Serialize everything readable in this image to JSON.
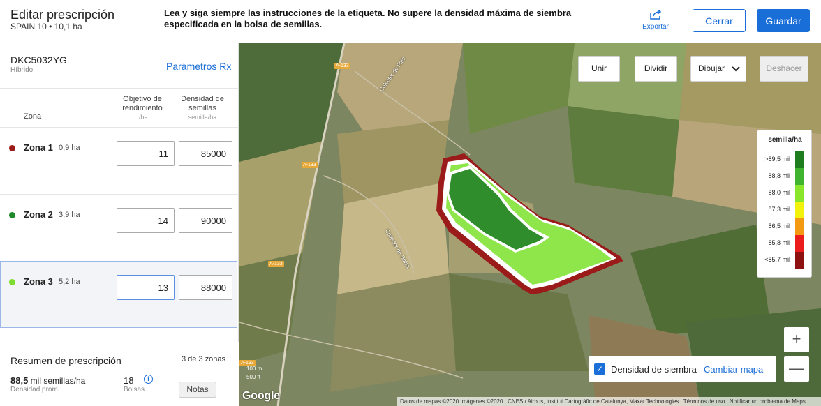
{
  "header": {
    "title": "Editar prescripción",
    "subtitle": "SPAIN 10 • 10,1 ha",
    "notice": "Lea y siga siempre las instrucciones de la etiqueta. No supere la densidad máxima de siembra especificada en la bolsa de semillas.",
    "export_label": "Exportar",
    "close_label": "Cerrar",
    "save_label": "Guardar"
  },
  "panel": {
    "hybrid": "DKC5032YG",
    "hybrid_sub": "Híbrido",
    "rx_link": "Parámetros Rx",
    "col_zone": "Zona",
    "col_yield": "Objetivo de rendimiento",
    "col_yield_unit": "t/ha",
    "col_density": "Densidad de semillas",
    "col_density_unit": "semilla/ha",
    "zones": [
      {
        "name": "Zona 1",
        "area": "0,9 ha",
        "yield": "11",
        "density": "85000",
        "color": "#9b1b1b"
      },
      {
        "name": "Zona 2",
        "area": "3,9 ha",
        "yield": "14",
        "density": "90000",
        "color": "#1e8a2a"
      },
      {
        "name": "Zona 3",
        "area": "5,2 ha",
        "yield": "13",
        "density": "88000",
        "color": "#7ddc2e"
      }
    ]
  },
  "summary": {
    "title": "Resumen de prescripción",
    "count": "3 de 3 zonas",
    "avg_value": "88,5",
    "avg_unit": "mil semillas/ha",
    "avg_label": "Densidad prom.",
    "bags_value": "18",
    "bags_label": "Bolsas",
    "notes_label": "Notas"
  },
  "map": {
    "buttons": {
      "join": "Unir",
      "split": "Dividir",
      "draw": "Dibujar",
      "undo": "Deshacer"
    },
    "legend": {
      "title": "semilla/ha",
      "items": [
        {
          "label": ">89,5 mil",
          "color": "#1e7d1e"
        },
        {
          "label": "88,8 mil",
          "color": "#3fb52f"
        },
        {
          "label": "88,0 mil",
          "color": "#8ae62a"
        },
        {
          "label": "87,3 mil",
          "color": "#f2f20a"
        },
        {
          "label": "86,5 mil",
          "color": "#f39a12"
        },
        {
          "label": "85,8 mil",
          "color": "#ea1c1c"
        },
        {
          "label": "<85,7 mil",
          "color": "#8e1111"
        }
      ]
    },
    "zoom_in": "+",
    "zoom_out": "—",
    "density_label": "Densidad de siembra",
    "change_map": "Cambiar mapa",
    "scale_m": "100 m",
    "scale_ft": "500 ft",
    "google": "Google",
    "attribution": "Datos de mapas ©2020 Imágenes ©2020 , CNES / Airbus, Institut Cartogràfic de Catalunya, Maxar Technologies   |   Términos de uso   |   Notificar un problema de Maps",
    "road_labels": [
      "A-133",
      "A-133",
      "A-133",
      "A-133"
    ],
    "street_labels": [
      "Colector de Fals",
      "Colector de Solsa"
    ]
  }
}
